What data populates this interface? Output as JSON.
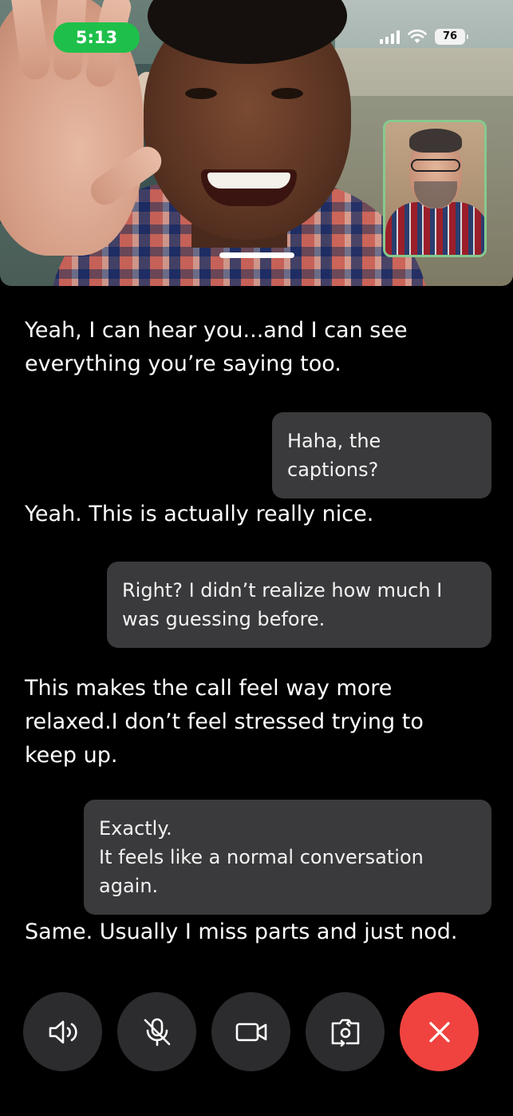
{
  "status_bar": {
    "time": "5:13",
    "battery": "76",
    "icons": [
      "signal-icon",
      "wifi-icon",
      "battery-icon"
    ],
    "time_pill_color": "#1ec04a"
  },
  "video": {
    "remote_participant": "remote-video",
    "self_view": "self-view-pip"
  },
  "transcript": [
    {
      "speaker": "remote",
      "text": "Yeah, I can hear you...and I can see everything you’re saying too."
    },
    {
      "speaker": "self",
      "text": "Haha, the captions?"
    },
    {
      "speaker": "remote",
      "text": "Yeah. This is actually really nice."
    },
    {
      "speaker": "self",
      "text": "Right? I didn’t realize how much I was guessing before."
    },
    {
      "speaker": "remote",
      "text": "This makes the call feel way more relaxed.I don’t feel stressed trying to keep up."
    },
    {
      "speaker": "self",
      "text": "Exactly.\nIt feels like a normal conversation again."
    },
    {
      "speaker": "remote",
      "text": "Same. Usually I miss parts and just nod."
    }
  ],
  "controls": {
    "items": [
      "speaker-icon",
      "mute-mic-icon",
      "video-camera-icon",
      "flip-camera-icon",
      "end-call-icon"
    ],
    "end_call_color": "#f0433f",
    "button_color": "#2c2c2e"
  }
}
